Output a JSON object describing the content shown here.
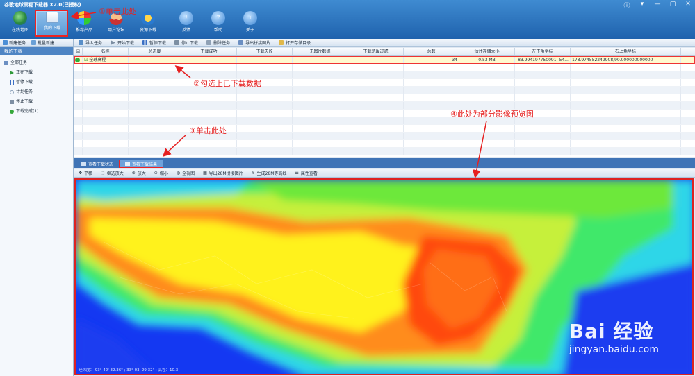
{
  "app": {
    "title": "谷歌地球高程下载器 X2.0(已授权)"
  },
  "ribbon": {
    "items": [
      {
        "label": "在线地图",
        "icon": "globe-icon"
      },
      {
        "label": "我的下载",
        "icon": "download-list-icon"
      },
      {
        "label": "推荐产品",
        "icon": "products-icon"
      },
      {
        "label": "用户论坛",
        "icon": "users-icon"
      },
      {
        "label": "资源下载",
        "icon": "resource-icon"
      },
      {
        "label": "反馈",
        "icon": "feedback-icon"
      },
      {
        "label": "帮助",
        "icon": "help-icon"
      },
      {
        "label": "关于",
        "icon": "info-icon"
      }
    ]
  },
  "left": {
    "toolbar": [
      "新建任务",
      "批量新建"
    ],
    "header": "我的下载",
    "tree": [
      {
        "label": "全部任务",
        "color": "#6b8fc2"
      },
      {
        "label": "正在下载",
        "color": "#2f9a3a"
      },
      {
        "label": "暂停下载",
        "color": "#3a6fc4"
      },
      {
        "label": "计划任务",
        "color": "#8aa0b8"
      },
      {
        "label": "停止下载",
        "color": "#7d8fa3"
      },
      {
        "label": "下载完成(1)",
        "color": "#34a83a"
      }
    ]
  },
  "main_toolbar": [
    "导入任务",
    "开始下载",
    "暂停下载",
    "停止下载",
    "删除任务",
    "导出拼接图片",
    "打开存储目录"
  ],
  "grid": {
    "columns": [
      "",
      "名称",
      "总进度",
      "下载成功",
      "下载失败",
      "无图片数据",
      "下载范围过滤",
      "总数",
      "估计存储大小",
      "左下角坐标",
      "右上角坐标"
    ],
    "rows": [
      [
        "",
        "全球高程",
        "",
        "",
        "",
        "",
        "",
        "34",
        "0.53 MB",
        "-83.994197750091,-54...",
        "178.974552249908,90.000000000000"
      ]
    ]
  },
  "tabs": [
    "查看下载状态",
    "查看下载结果"
  ],
  "view_toolbar": [
    "平移",
    "框选放大",
    "放大",
    "缩小",
    "全视图",
    "导出28M拼接图片",
    "生成28M等高线",
    "属性查看"
  ],
  "status": "经纬度：  93° 42' 32.36\" ; 33° 03' 29.32\"  ; 高程：10.3",
  "annotations": {
    "a1": "①单击此处",
    "a2": "②勾选上已下载数据",
    "a3": "③单击此处",
    "a4": "④此处为部分影像预览图"
  },
  "watermark": {
    "brand": "Bai 经验",
    "url": "jingyan.baidu.com"
  },
  "colors": {
    "accent": "#1f62ad",
    "highlight": "#e22222"
  }
}
